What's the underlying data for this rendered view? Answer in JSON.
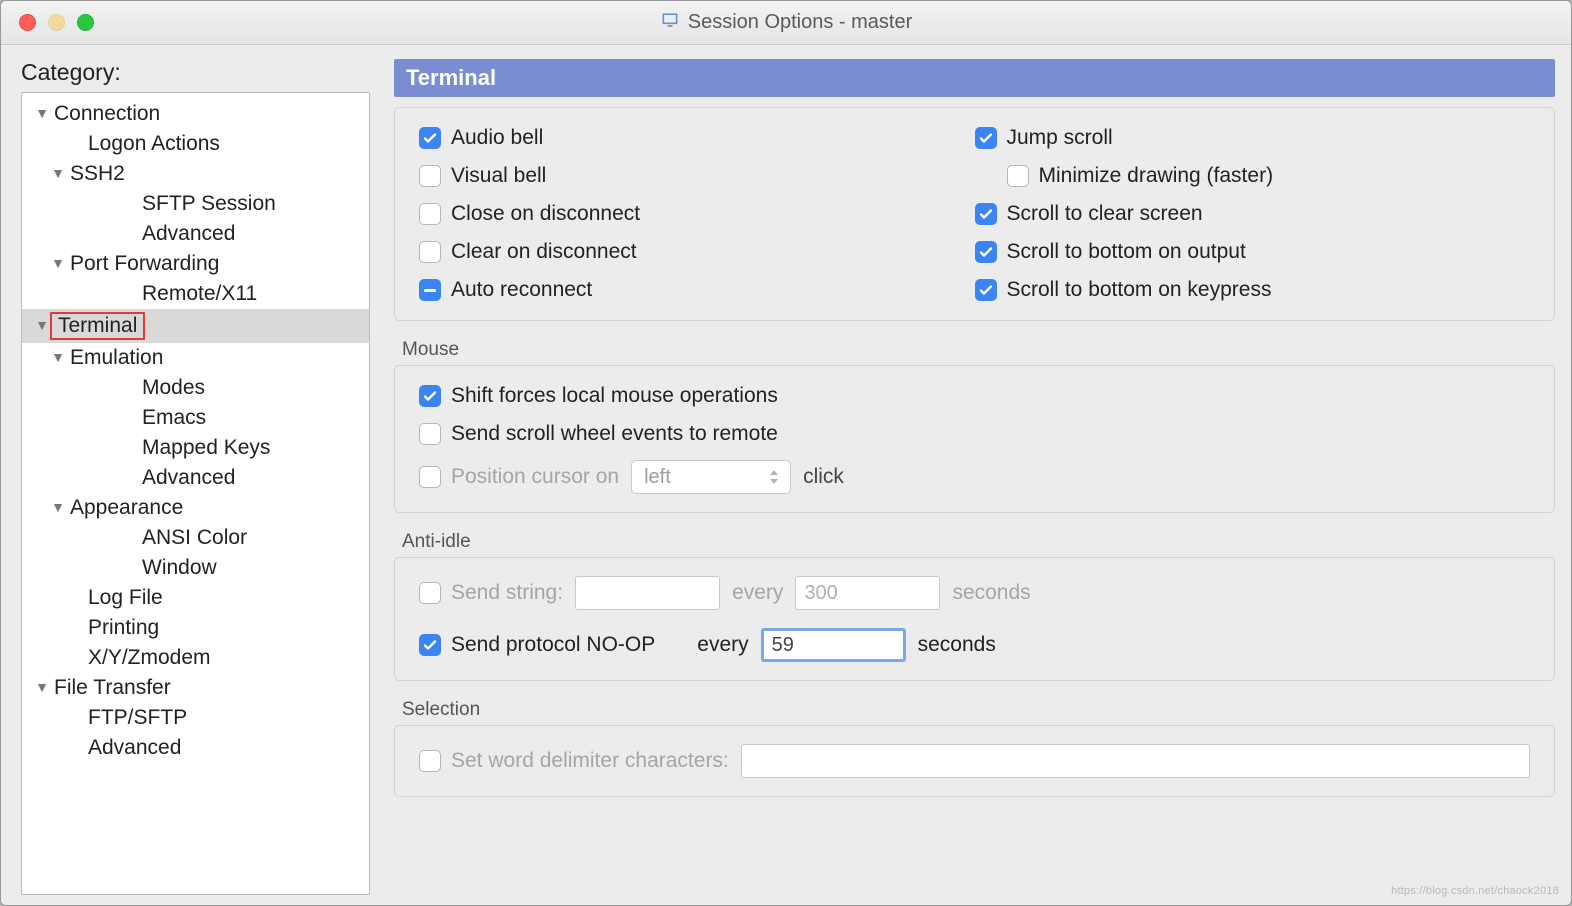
{
  "window": {
    "title": "Session Options - master"
  },
  "sidebar": {
    "label": "Category:",
    "items": {
      "connection": "Connection",
      "logon_actions": "Logon Actions",
      "ssh2": "SSH2",
      "sftp_session": "SFTP Session",
      "advanced_ssh2": "Advanced",
      "port_forwarding": "Port Forwarding",
      "remote_x11": "Remote/X11",
      "terminal": "Terminal",
      "emulation": "Emulation",
      "modes": "Modes",
      "emacs": "Emacs",
      "mapped_keys": "Mapped Keys",
      "advanced_emu": "Advanced",
      "appearance": "Appearance",
      "ansi_color": "ANSI Color",
      "window_item": "Window",
      "log_file": "Log File",
      "printing": "Printing",
      "xyzmodem": "X/Y/Zmodem",
      "file_transfer": "File Transfer",
      "ftp_sftp": "FTP/SFTP",
      "advanced_ft": "Advanced"
    }
  },
  "main": {
    "header": "Terminal",
    "top": {
      "audio_bell": "Audio bell",
      "visual_bell": "Visual bell",
      "close_on_disconnect": "Close on disconnect",
      "clear_on_disconnect": "Clear on disconnect",
      "auto_reconnect": "Auto reconnect",
      "jump_scroll": "Jump scroll",
      "minimize_drawing": "Minimize drawing (faster)",
      "scroll_clear": "Scroll to clear screen",
      "scroll_bottom_output": "Scroll to bottom on output",
      "scroll_bottom_keypress": "Scroll to bottom on keypress"
    },
    "mouse": {
      "title": "Mouse",
      "shift_local": "Shift forces local mouse operations",
      "send_wheel": "Send scroll wheel events to remote",
      "position_cursor": "Position cursor on",
      "click_word": "click",
      "select_value": "left"
    },
    "anti_idle": {
      "title": "Anti-idle",
      "send_string": "Send string:",
      "send_string_value": "",
      "every": "every",
      "string_interval": "300",
      "seconds": "seconds",
      "send_noop": "Send protocol NO-OP",
      "noop_interval": "59"
    },
    "selection": {
      "title": "Selection",
      "set_delim": "Set word delimiter characters:",
      "value": ""
    }
  },
  "watermark": "https://blog.csdn.net/chaock2018"
}
